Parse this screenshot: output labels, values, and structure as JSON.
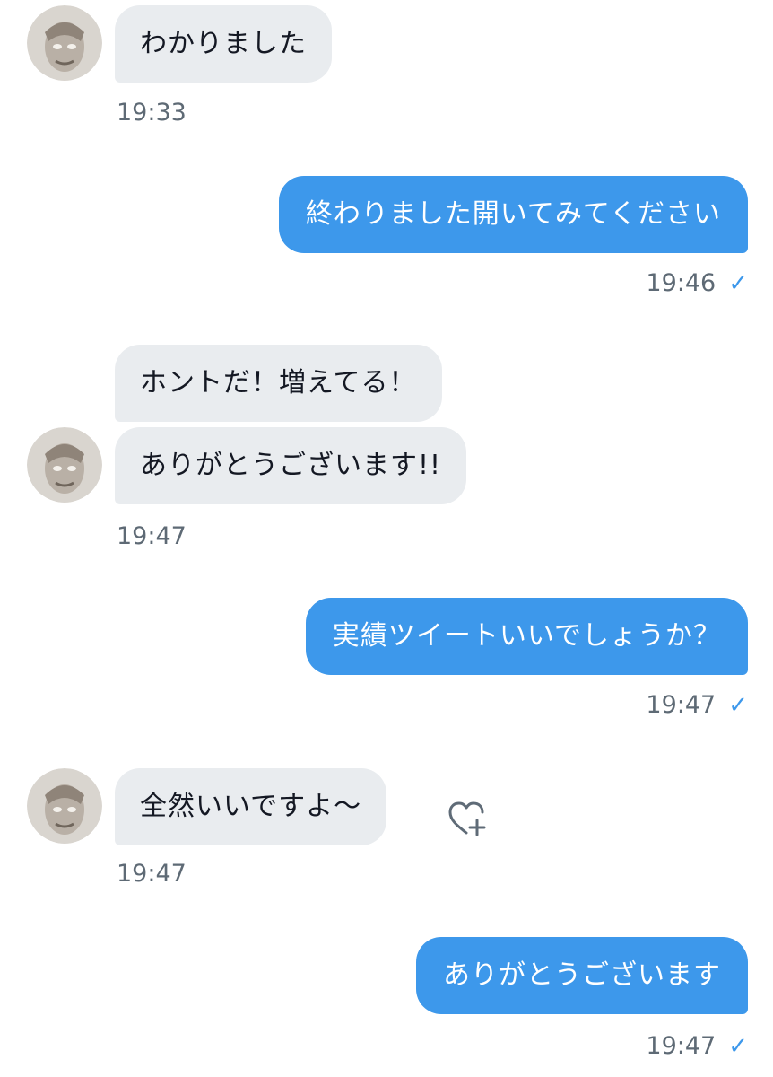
{
  "messages": [
    {
      "side": "in",
      "text": "わかりました"
    },
    {
      "side": "in_time",
      "text": "19:33"
    },
    {
      "side": "out",
      "text": "終わりました開いてみてください"
    },
    {
      "side": "out_time",
      "text": "19:46"
    },
    {
      "side": "in",
      "text": "ホントだ！増えてる！"
    },
    {
      "side": "in",
      "text": "ありがとうございます!!"
    },
    {
      "side": "in_time",
      "text": "19:47"
    },
    {
      "side": "out",
      "text": "実績ツイートいいでしょうか？"
    },
    {
      "side": "out_time",
      "text": "19:47"
    },
    {
      "side": "in",
      "text": "全然いいですよ〜"
    },
    {
      "side": "in_time",
      "text": "19:47"
    },
    {
      "side": "out",
      "text": "ありがとうございます"
    },
    {
      "side": "out_time",
      "text": "19:47"
    }
  ],
  "icons": {
    "read_receipt": "check-icon",
    "reaction": "heart-plus-icon",
    "avatar": "avatar"
  },
  "colors": {
    "incoming_bubble": "#e9ecef",
    "outgoing_bubble": "#3d98eb",
    "timestamp": "#5e6a75",
    "read_check": "#3d98eb"
  }
}
